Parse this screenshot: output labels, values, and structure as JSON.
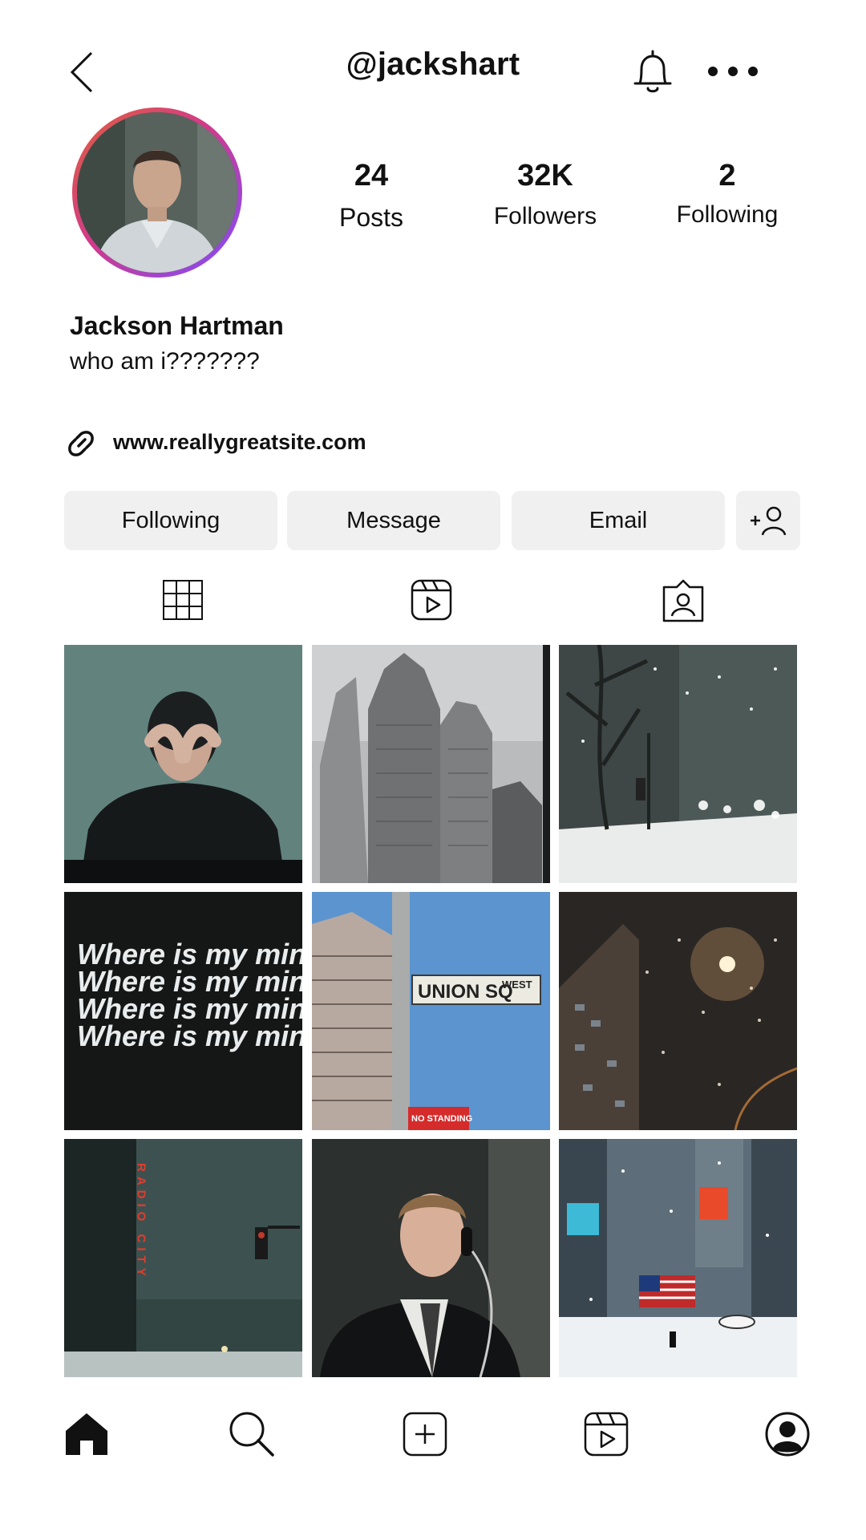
{
  "header": {
    "handle": "@jackshart",
    "back_icon": "chevron-left-icon",
    "bell_icon": "bell-icon",
    "more_icon": "more-horizontal-icon"
  },
  "profile": {
    "posts_count": "24",
    "posts_label": "Posts",
    "followers_count": "32K",
    "followers_label": "Followers",
    "following_count": "2",
    "following_label": "Following",
    "name": "Jackson Hartman",
    "bio": "who am i???????",
    "website": "www.reallygreatsite.com",
    "avatar_ring_colors": [
      "#e0603a",
      "#d23a8a",
      "#7c4dff"
    ]
  },
  "actions": {
    "following_label": "Following",
    "message_label": "Message",
    "email_label": "Email",
    "add_user_icon": "add-user-icon"
  },
  "tabs": [
    {
      "icon": "grid-icon"
    },
    {
      "icon": "reels-icon"
    },
    {
      "icon": "tagged-icon"
    }
  ],
  "grid": [
    {
      "subject": "man covering face"
    },
    {
      "subject": "foggy skyscrapers"
    },
    {
      "subject": "snowy street at night"
    },
    {
      "subject": "where is my mind text",
      "text": "Where is my mind?"
    },
    {
      "subject": "union square street sign",
      "sign": "UNION SQ",
      "sign_small": "WEST",
      "sign2": "NO STANDING"
    },
    {
      "subject": "snow under street lamp"
    },
    {
      "subject": "radio city in fog",
      "sign": "RADIO CITY"
    },
    {
      "subject": "man on payphone"
    },
    {
      "subject": "times square in snow"
    }
  ],
  "bottom_nav": [
    {
      "icon": "home-icon"
    },
    {
      "icon": "search-icon"
    },
    {
      "icon": "new-post-icon"
    },
    {
      "icon": "reels-icon"
    },
    {
      "icon": "profile-icon"
    }
  ]
}
